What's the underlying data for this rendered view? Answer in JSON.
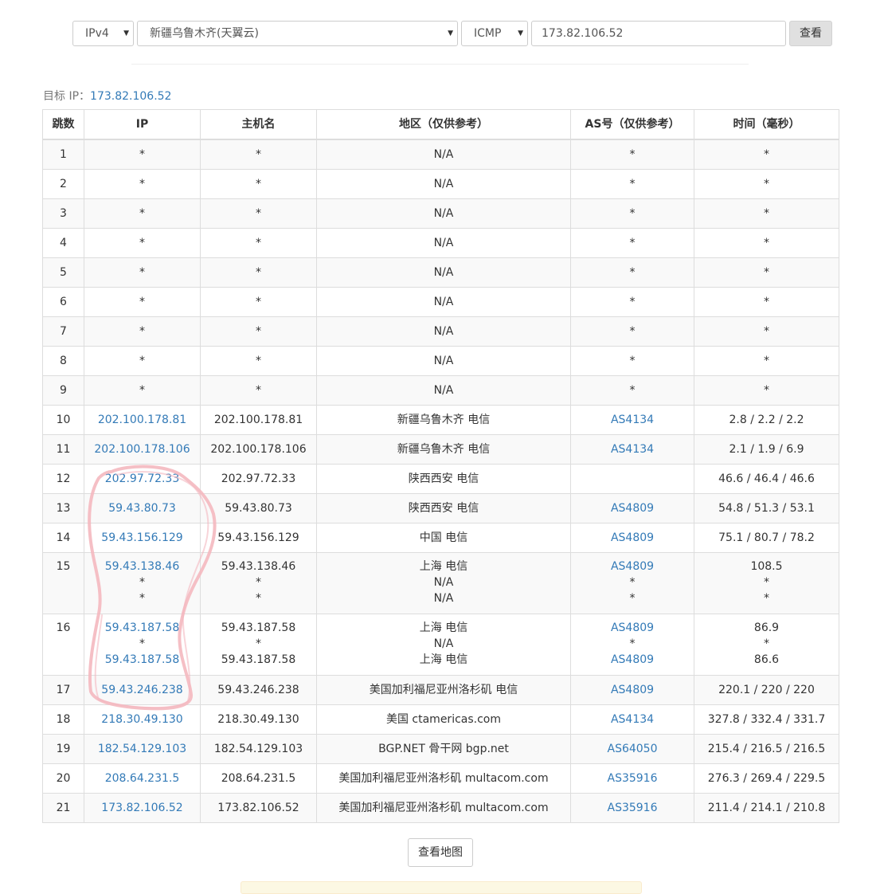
{
  "toolbar": {
    "ip_version": "IPv4",
    "node": "新疆乌鲁木齐(天翼云)",
    "protocol": "ICMP",
    "target_value": "173.82.106.52",
    "query_label": "查看"
  },
  "target": {
    "label": "目标 IP：",
    "ip": "173.82.106.52"
  },
  "table": {
    "headers": [
      "跳数",
      "IP",
      "主机名",
      "地区（仅供参考）",
      "AS号（仅供参考）",
      "时间（毫秒）"
    ]
  },
  "hops": [
    {
      "hop": "1",
      "ip": [
        "*"
      ],
      "host": [
        "*"
      ],
      "region": [
        "N/A"
      ],
      "as": [
        "*"
      ],
      "time": [
        "*"
      ]
    },
    {
      "hop": "2",
      "ip": [
        "*"
      ],
      "host": [
        "*"
      ],
      "region": [
        "N/A"
      ],
      "as": [
        "*"
      ],
      "time": [
        "*"
      ]
    },
    {
      "hop": "3",
      "ip": [
        "*"
      ],
      "host": [
        "*"
      ],
      "region": [
        "N/A"
      ],
      "as": [
        "*"
      ],
      "time": [
        "*"
      ]
    },
    {
      "hop": "4",
      "ip": [
        "*"
      ],
      "host": [
        "*"
      ],
      "region": [
        "N/A"
      ],
      "as": [
        "*"
      ],
      "time": [
        "*"
      ]
    },
    {
      "hop": "5",
      "ip": [
        "*"
      ],
      "host": [
        "*"
      ],
      "region": [
        "N/A"
      ],
      "as": [
        "*"
      ],
      "time": [
        "*"
      ]
    },
    {
      "hop": "6",
      "ip": [
        "*"
      ],
      "host": [
        "*"
      ],
      "region": [
        "N/A"
      ],
      "as": [
        "*"
      ],
      "time": [
        "*"
      ]
    },
    {
      "hop": "7",
      "ip": [
        "*"
      ],
      "host": [
        "*"
      ],
      "region": [
        "N/A"
      ],
      "as": [
        "*"
      ],
      "time": [
        "*"
      ]
    },
    {
      "hop": "8",
      "ip": [
        "*"
      ],
      "host": [
        "*"
      ],
      "region": [
        "N/A"
      ],
      "as": [
        "*"
      ],
      "time": [
        "*"
      ]
    },
    {
      "hop": "9",
      "ip": [
        "*"
      ],
      "host": [
        "*"
      ],
      "region": [
        "N/A"
      ],
      "as": [
        "*"
      ],
      "time": [
        "*"
      ]
    },
    {
      "hop": "10",
      "ip": [
        "202.100.178.81"
      ],
      "host": [
        "202.100.178.81"
      ],
      "region": [
        "新疆乌鲁木齐 电信"
      ],
      "as": [
        "AS4134"
      ],
      "time": [
        "2.8 / 2.2 / 2.2"
      ]
    },
    {
      "hop": "11",
      "ip": [
        "202.100.178.106"
      ],
      "host": [
        "202.100.178.106"
      ],
      "region": [
        "新疆乌鲁木齐 电信"
      ],
      "as": [
        "AS4134"
      ],
      "time": [
        "2.1 / 1.9 / 6.9"
      ]
    },
    {
      "hop": "12",
      "ip": [
        "202.97.72.33"
      ],
      "host": [
        "202.97.72.33"
      ],
      "region": [
        "陕西西安 电信"
      ],
      "as": [
        ""
      ],
      "time": [
        "46.6 / 46.4 / 46.6"
      ]
    },
    {
      "hop": "13",
      "ip": [
        "59.43.80.73"
      ],
      "host": [
        "59.43.80.73"
      ],
      "region": [
        "陕西西安 电信"
      ],
      "as": [
        "AS4809"
      ],
      "time": [
        "54.8 / 51.3 / 53.1"
      ]
    },
    {
      "hop": "14",
      "ip": [
        "59.43.156.129"
      ],
      "host": [
        "59.43.156.129"
      ],
      "region": [
        "中国 电信"
      ],
      "as": [
        "AS4809"
      ],
      "time": [
        "75.1 / 80.7 / 78.2"
      ]
    },
    {
      "hop": "15",
      "ip": [
        "59.43.138.46",
        "*",
        "*"
      ],
      "host": [
        "59.43.138.46",
        "*",
        "*"
      ],
      "region": [
        "上海 电信",
        "N/A",
        "N/A"
      ],
      "as": [
        "AS4809",
        "*",
        "*"
      ],
      "time": [
        "108.5",
        "*",
        "*"
      ]
    },
    {
      "hop": "16",
      "ip": [
        "59.43.187.58",
        "*",
        "59.43.187.58"
      ],
      "host": [
        "59.43.187.58",
        "*",
        "59.43.187.58"
      ],
      "region": [
        "上海 电信",
        "N/A",
        "上海 电信"
      ],
      "as": [
        "AS4809",
        "*",
        "AS4809"
      ],
      "time": [
        "86.9",
        "*",
        "86.6"
      ]
    },
    {
      "hop": "17",
      "ip": [
        "59.43.246.238"
      ],
      "host": [
        "59.43.246.238"
      ],
      "region": [
        "美国加利福尼亚州洛杉矶 电信"
      ],
      "as": [
        "AS4809"
      ],
      "time": [
        "220.1 / 220 / 220"
      ]
    },
    {
      "hop": "18",
      "ip": [
        "218.30.49.130"
      ],
      "host": [
        "218.30.49.130"
      ],
      "region": [
        "美国 ctamericas.com"
      ],
      "as": [
        "AS4134"
      ],
      "time": [
        "327.8 / 332.4 / 331.7"
      ]
    },
    {
      "hop": "19",
      "ip": [
        "182.54.129.103"
      ],
      "host": [
        "182.54.129.103"
      ],
      "region": [
        "BGP.NET 骨干网 bgp.net"
      ],
      "as": [
        "AS64050"
      ],
      "time": [
        "215.4 / 216.5 / 216.5"
      ]
    },
    {
      "hop": "20",
      "ip": [
        "208.64.231.5"
      ],
      "host": [
        "208.64.231.5"
      ],
      "region": [
        "美国加利福尼亚州洛杉矶 multacom.com"
      ],
      "as": [
        "AS35916"
      ],
      "time": [
        "276.3 / 269.4 / 229.5"
      ]
    },
    {
      "hop": "21",
      "ip": [
        "173.82.106.52"
      ],
      "host": [
        "173.82.106.52"
      ],
      "region": [
        "美国加利福尼亚州洛杉矶 multacom.com"
      ],
      "as": [
        "AS35916"
      ],
      "time": [
        "211.4 / 214.1 / 210.8"
      ]
    }
  ],
  "map_button_label": "查看地图",
  "colors": {
    "link": "#337ab7",
    "annotation": "#f4b8bf",
    "stripe": "#f9f9f9"
  }
}
